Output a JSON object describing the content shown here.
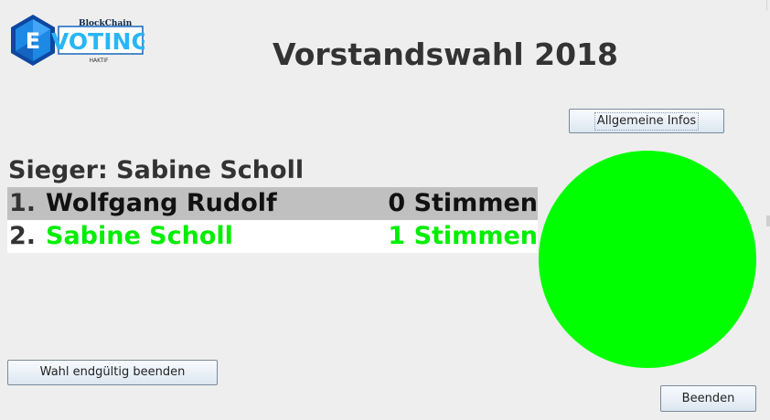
{
  "logo": {
    "letter": "E",
    "word": "VOTING",
    "top_text": "BlockChain",
    "bottom_text": "HAKTIF"
  },
  "title": "Vorstandswahl 2018",
  "buttons": {
    "info": "Allgemeine Infos",
    "end_vote": "Wahl endgültig beenden",
    "quit": "Beenden"
  },
  "winner_text": "Sieger: Sabine Scholl",
  "results": [
    {
      "rank": "1.",
      "name": "Wolfgang Rudolf",
      "votes_label": "0 Stimmen",
      "votes": 0,
      "color": "#111111"
    },
    {
      "rank": "2.",
      "name": "Sabine Scholl",
      "votes_label": "1 Stimmen",
      "votes": 1,
      "color": "#00ee00"
    }
  ],
  "chart_data": {
    "type": "pie",
    "categories": [
      "Wolfgang Rudolf",
      "Sabine Scholl"
    ],
    "values": [
      0,
      1
    ],
    "colors": [
      "#111111",
      "#00ff00"
    ]
  },
  "colors": {
    "winner": "#00ee00",
    "pie_winner": "#00ff00",
    "row_highlight": "#c0c0c0",
    "logo_blue": "#1565c0",
    "logo_accent": "#29b6f6"
  }
}
